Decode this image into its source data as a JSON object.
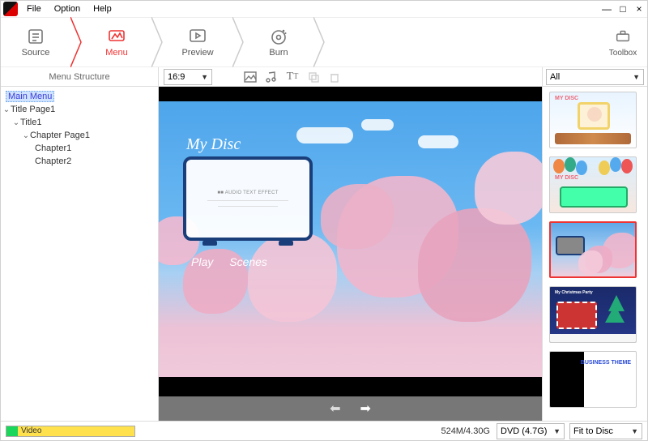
{
  "menus": {
    "file": "File",
    "option": "Option",
    "help": "Help"
  },
  "window_buttons": {
    "min": "—",
    "max": "□",
    "close": "×"
  },
  "steps": {
    "source": "Source",
    "menu": "Menu",
    "preview": "Preview",
    "burn": "Burn",
    "toolbox": "Toolbox"
  },
  "panel_title": "Menu Structure",
  "aspect": {
    "value": "16:9"
  },
  "template_filter": {
    "value": "All"
  },
  "tree": {
    "main_menu": "Main Menu",
    "title_page": "Title Page1",
    "title1": "Title1",
    "chapter_page": "Chapter Page1",
    "chapter1": "Chapter1",
    "chapter2": "Chapter2"
  },
  "disc": {
    "title": "My Disc",
    "play": "Play",
    "scenes": "Scenes",
    "frame_line": "■■ AUDIO TEXT EFFECT"
  },
  "templates": [
    {
      "name": "baby",
      "label": "MY DISC",
      "selected": false
    },
    {
      "name": "balloons",
      "label": "MY DISC",
      "selected": false
    },
    {
      "name": "blossom",
      "label": "",
      "selected": true
    },
    {
      "name": "christmas",
      "label": "My Christmas Party",
      "selected": false
    },
    {
      "name": "business",
      "label": "BUSINESS THEME",
      "selected": false
    }
  ],
  "status": {
    "video_label": "Video",
    "size": "524M/4.30G",
    "disc_type": "DVD (4.7G)",
    "fit": "Fit to Disc"
  }
}
